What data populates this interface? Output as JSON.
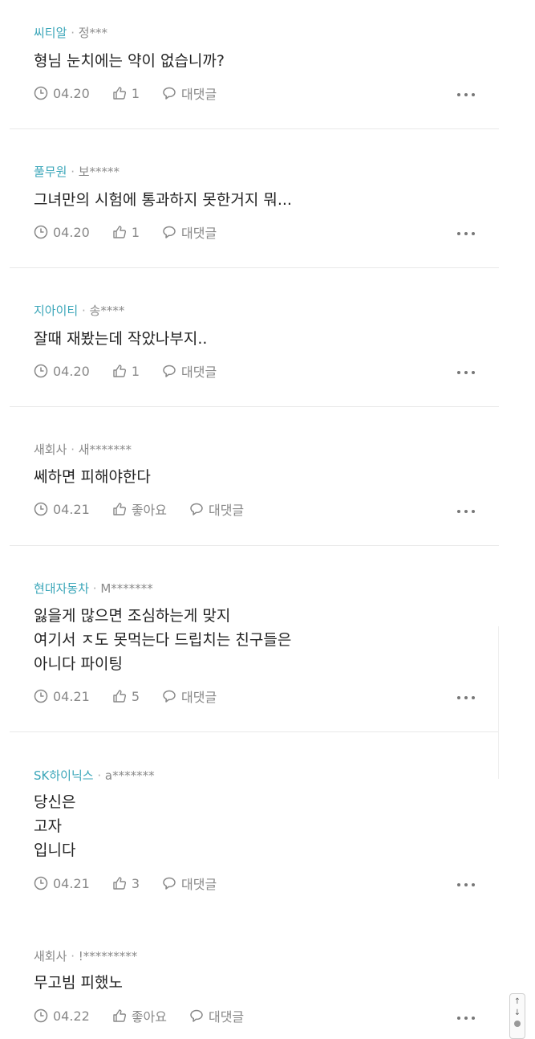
{
  "comments": [
    {
      "company": "씨티알",
      "company_colored": true,
      "separator": "·",
      "user": "정***",
      "text": "형님 눈치에는 약이 없습니까?",
      "date": "04.20",
      "likes": "1",
      "reply_label": "대댓글"
    },
    {
      "company": "풀무원",
      "company_colored": true,
      "separator": "·",
      "user": "보*****",
      "text": "그녀만의 시험에 통과하지 못한거지 뭐...",
      "date": "04.20",
      "likes": "1",
      "reply_label": "대댓글"
    },
    {
      "company": "지아이티",
      "company_colored": true,
      "separator": "·",
      "user": "송****",
      "text": "잘때 재봤는데 작았나부지..",
      "date": "04.20",
      "likes": "1",
      "reply_label": "대댓글"
    },
    {
      "company": "새회사",
      "company_colored": false,
      "separator": "·",
      "user": "새*******",
      "text": "쎄하면 피해야한다",
      "date": "04.21",
      "likes": "좋아요",
      "reply_label": "대댓글"
    },
    {
      "company": "현대자동차",
      "company_colored": true,
      "separator": "·",
      "user": "M*******",
      "text": "잃을게 많으면 조심하는게 맞지\n여기서 ㅈ도 못먹는다 드립치는 친구들은\n아니다 파이팅",
      "date": "04.21",
      "likes": "5",
      "reply_label": "대댓글"
    },
    {
      "company": "SK하이닉스",
      "company_colored": true,
      "separator": "·",
      "user": "a*******",
      "text": "당신은\n고자\n입니다",
      "date": "04.21",
      "likes": "3",
      "reply_label": "대댓글"
    },
    {
      "company": "새회사",
      "company_colored": false,
      "separator": "·",
      "user": "!*********",
      "text": "무고빔 피했노",
      "date": "04.22",
      "likes": "좋아요",
      "reply_label": "대댓글"
    }
  ],
  "scrollbar": {
    "up": "↑",
    "down": "↓"
  },
  "colors": {
    "company": "#3aa6b9",
    "meta_gray": "#8a8a8a",
    "text": "#222222",
    "divider": "#e8e8e8"
  }
}
